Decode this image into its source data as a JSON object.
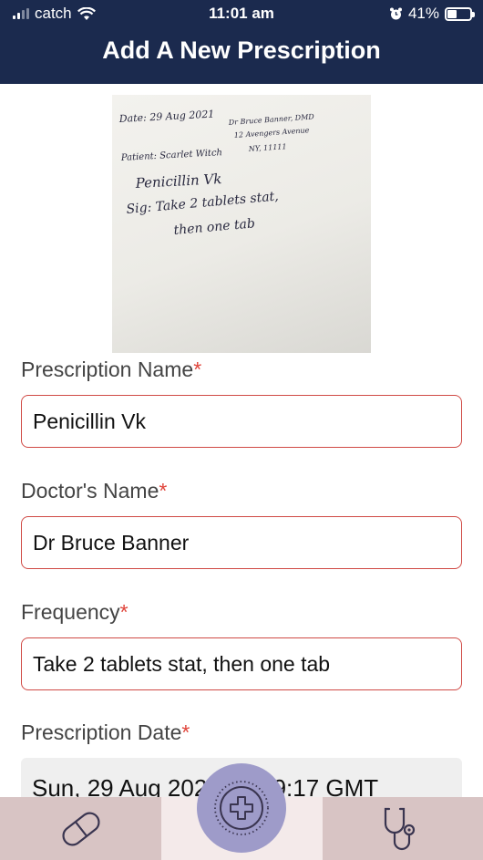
{
  "status_bar": {
    "carrier": "catch",
    "time": "11:01 am",
    "battery": "41%",
    "icons": [
      "signal-icon",
      "wifi-icon",
      "alarm-icon",
      "battery-icon"
    ]
  },
  "header": {
    "title": "Add A New Prescription"
  },
  "photo": {
    "handwriting": {
      "date": "Date: 29 Aug 2021",
      "doctor_line1": "Dr Bruce Banner, DMD",
      "doctor_line2": "12 Avengers Avenue",
      "doctor_line3": "NY, 11111",
      "patient": "Patient: Scarlet Witch",
      "drug": "Penicillin Vk",
      "sig_line1": "Sig: Take 2 tablets stat,",
      "sig_line2": "then one tab"
    }
  },
  "form": {
    "prescription_name": {
      "label": "Prescription Name",
      "required_mark": "*",
      "value": "Penicillin Vk"
    },
    "doctor_name": {
      "label": "Doctor's Name",
      "required_mark": "*",
      "value": "Dr Bruce Banner"
    },
    "frequency": {
      "label": "Frequency",
      "required_mark": "*",
      "value": "Take 2 tablets stat, then one tab"
    },
    "prescription_date": {
      "label": "Prescription Date",
      "required_mark": "*",
      "value": "Sun, 29 Aug 2021 10:59:17 GMT"
    }
  },
  "tab_bar": {
    "tabs": [
      {
        "name": "medications",
        "icon": "pill-icon"
      },
      {
        "name": "add",
        "icon": "plus-circle-icon"
      },
      {
        "name": "doctors",
        "icon": "stethoscope-icon"
      }
    ]
  },
  "colors": {
    "header_bg": "#1b2a4e",
    "field_border": "#d04a45",
    "required": "#e0443a",
    "tabbar_bg": "#d8c4c4",
    "tab_active_bg": "#f4eaea",
    "fab_bg": "#9e9bc9"
  }
}
